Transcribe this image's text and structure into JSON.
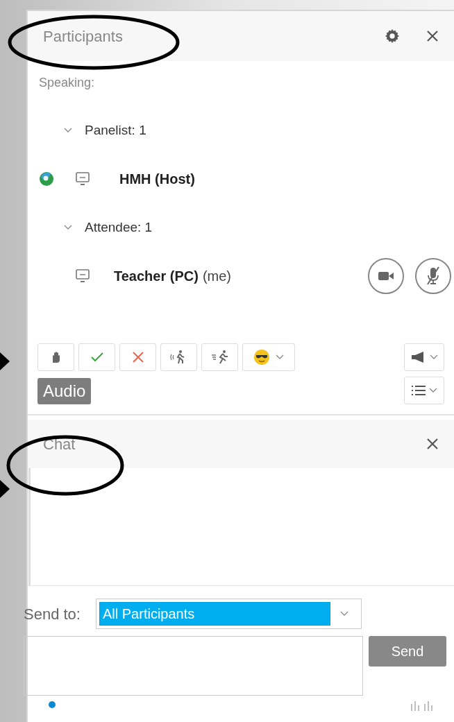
{
  "participants": {
    "title": "Participants",
    "speaking_label": "Speaking:",
    "groups": [
      {
        "label": "Panelist: 1",
        "expanded": true,
        "members": [
          {
            "name": "HMH (Host)",
            "presenter": true,
            "media_controls": false
          }
        ]
      },
      {
        "label": "Attendee: 1",
        "expanded": true,
        "members": [
          {
            "name": "Teacher (PC)",
            "note": "(me)",
            "presenter": false,
            "media_controls": true,
            "mic_muted": true
          }
        ]
      }
    ],
    "reactions": [
      {
        "kind": "hand"
      },
      {
        "kind": "yes"
      },
      {
        "kind": "no"
      },
      {
        "kind": "away"
      },
      {
        "kind": "faster"
      },
      {
        "kind": "emoji"
      }
    ],
    "audio_label": "Audio"
  },
  "chat": {
    "title": "Chat",
    "send_to_label": "Send to:",
    "send_to_value": "All Participants",
    "send_button": "Send"
  }
}
